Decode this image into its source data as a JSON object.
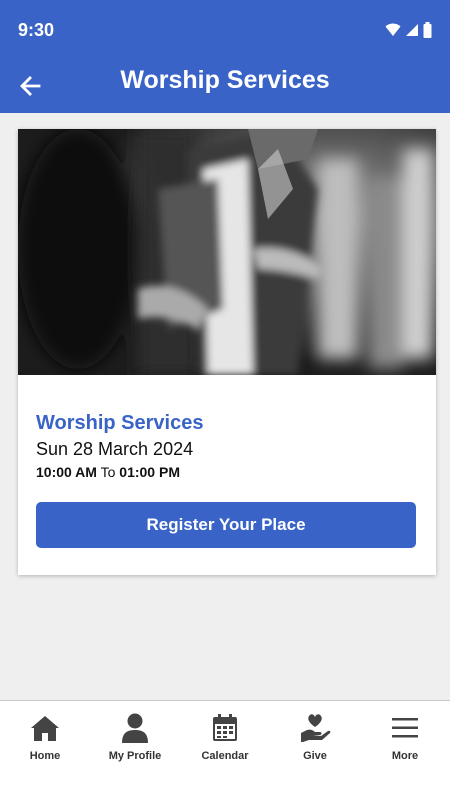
{
  "status_bar": {
    "time": "9:30"
  },
  "app_bar": {
    "title": "Worship Services"
  },
  "event_card": {
    "title": "Worship Services",
    "date": "Sun 28 March 2024",
    "start_time": "10:00 AM",
    "time_separator": "To",
    "end_time": "01:00 PM",
    "register_label": "Register Your Place"
  },
  "bottom_nav": {
    "items": [
      {
        "label": "Home",
        "icon": "home-icon"
      },
      {
        "label": "My Profile",
        "icon": "person-icon"
      },
      {
        "label": "Calendar",
        "icon": "calendar-icon"
      },
      {
        "label": "Give",
        "icon": "give-heart-hand-icon"
      },
      {
        "label": "More",
        "icon": "menu-icon"
      }
    ]
  },
  "colors": {
    "primary": "#3a63c8",
    "background": "#efefef",
    "nav_icon": "#444444"
  }
}
